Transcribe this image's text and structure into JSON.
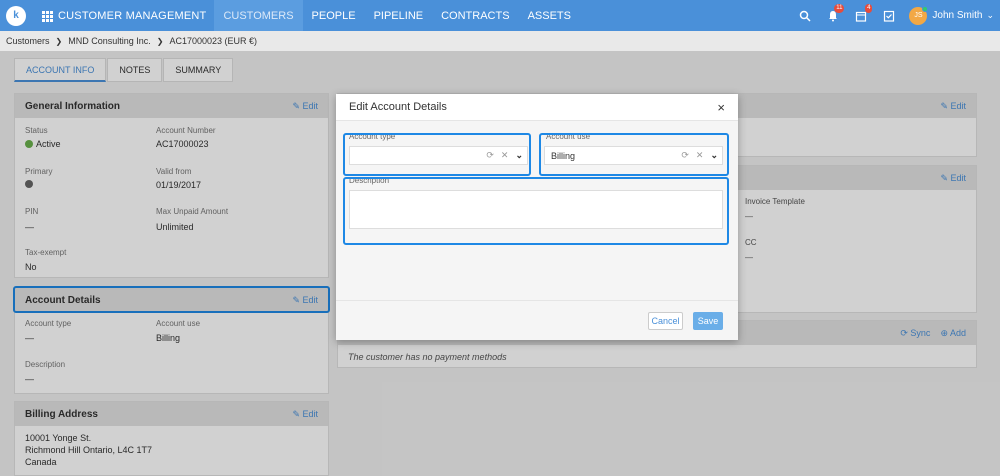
{
  "topbar": {
    "logo": "k",
    "app_title": "CUSTOMER MANAGEMENT",
    "nav": [
      "CUSTOMERS",
      "PEOPLE",
      "PIPELINE",
      "CONTRACTS",
      "ASSETS"
    ],
    "active_nav": "CUSTOMERS",
    "notifications_count": "11",
    "tasks_count": "4",
    "user_initials": "JS",
    "user_name": "John Smith"
  },
  "breadcrumb": [
    "Customers",
    "MND Consulting Inc.",
    "AC17000023 (EUR €)"
  ],
  "tabs": [
    "ACCOUNT INFO",
    "NOTES",
    "SUMMARY"
  ],
  "general_info": {
    "title": "General Information",
    "edit": "Edit",
    "status_label": "Status",
    "status_value": "Active",
    "account_number_label": "Account Number",
    "account_number_value": "AC17000023",
    "primary_label": "Primary",
    "valid_from_label": "Valid from",
    "valid_from_value": "01/19/2017",
    "pin_label": "PIN",
    "pin_value": "—",
    "max_unpaid_label": "Max Unpaid Amount",
    "max_unpaid_value": "Unlimited",
    "tax_exempt_label": "Tax-exempt",
    "tax_exempt_value": "No"
  },
  "account_details": {
    "title": "Account Details",
    "edit": "Edit",
    "account_type_label": "Account type",
    "account_type_value": "—",
    "account_use_label": "Account use",
    "account_use_value": "Billing",
    "description_label": "Description",
    "description_value": "—"
  },
  "billing_address": {
    "title": "Billing Address",
    "edit": "Edit",
    "line1": "10001 Yonge St.",
    "line2": "Richmond Hill Ontario, L4C 1T7",
    "line3": "Canada"
  },
  "right_panels": {
    "edit": "Edit",
    "invoice_template_label": "Invoice Template",
    "invoice_template_value": "—",
    "cc_label": "CC",
    "cc_value": "—",
    "sync": "Sync",
    "add": "Add",
    "no_payment_methods": "The customer has no payment methods"
  },
  "modal": {
    "title": "Edit Account Details",
    "close": "×",
    "account_type_label": "Account type",
    "account_type_value": "",
    "account_use_label": "Account use",
    "account_use_value": "Billing",
    "description_label": "Description",
    "cancel": "Cancel",
    "save": "Save"
  }
}
